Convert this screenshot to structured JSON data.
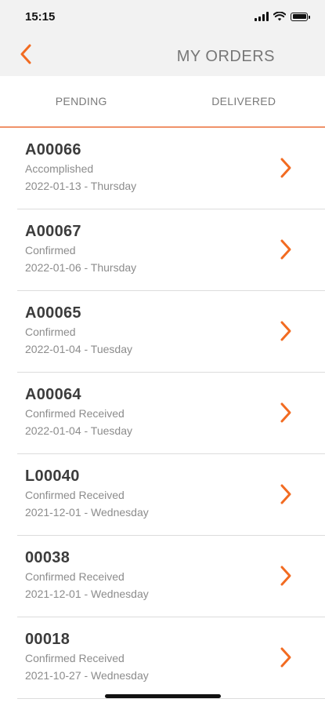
{
  "status_bar": {
    "time": "15:15"
  },
  "header": {
    "title": "MY ORDERS"
  },
  "tabs": [
    {
      "label": "PENDING"
    },
    {
      "label": "DELIVERED"
    }
  ],
  "orders": [
    {
      "id": "A00066",
      "status": "Accomplished",
      "date": "2022-01-13 - Thursday"
    },
    {
      "id": "A00067",
      "status": "Confirmed",
      "date": "2022-01-06 - Thursday"
    },
    {
      "id": "A00065",
      "status": "Confirmed",
      "date": "2022-01-04 - Tuesday"
    },
    {
      "id": "A00064",
      "status": "Confirmed Received",
      "date": "2022-01-04 - Tuesday"
    },
    {
      "id": "L00040",
      "status": "Confirmed Received",
      "date": "2021-12-01 - Wednesday"
    },
    {
      "id": "00038",
      "status": "Confirmed Received",
      "date": "2021-12-01 - Wednesday"
    },
    {
      "id": "00018",
      "status": "Confirmed Received",
      "date": "2021-10-27 - Wednesday"
    }
  ],
  "colors": {
    "accent": "#f26b21",
    "tab_underline": "#f0926a",
    "header_bg": "#f2f2f2"
  },
  "icons": {
    "back": "chevron-left-icon",
    "row_arrow": "chevron-right-icon"
  }
}
